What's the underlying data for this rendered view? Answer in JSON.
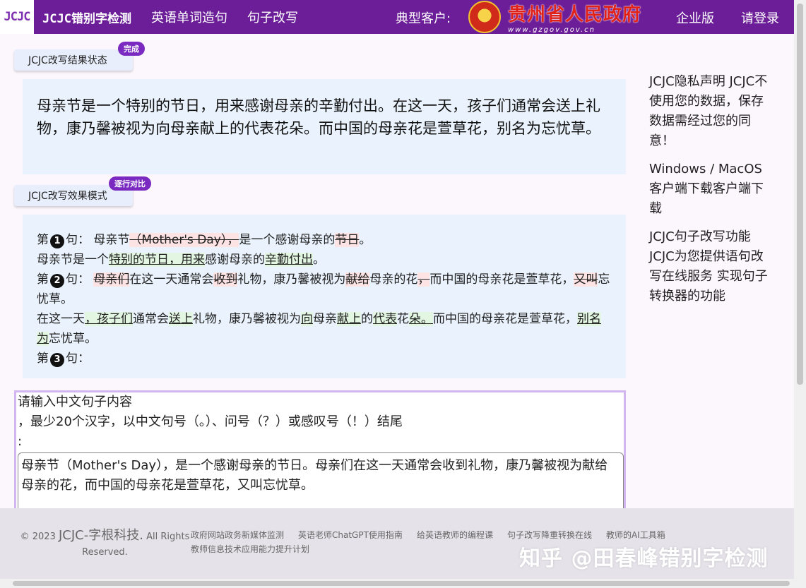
{
  "nav": {
    "logo": "JCJC",
    "links": [
      "JCJC错别字检测",
      "英语单词造句",
      "句子改写"
    ],
    "customer_label": "典型客户:",
    "gov_name": "贵州省人民政府",
    "gov_url": "www.gzgov.gov.cn",
    "enterprise": "企业版",
    "login": "请登录"
  },
  "status": {
    "label": "JCJC改写结果状态",
    "badge": "完成"
  },
  "result_text": "母亲节是一个特别的节日，用来感谢母亲的辛勤付出。在这一天，孩子们通常会送上礼物，康乃馨被视为向母亲献上的代表花朵。而中国的母亲花是萱草花，别名为忘忧草。",
  "mode": {
    "label": "JCJC改写效果模式",
    "badge": "逐行对比"
  },
  "compare": {
    "line_prefix": "第",
    "line_suffix": "句：",
    "s1": {
      "num": "1",
      "parts": [
        {
          "t": "母亲节",
          "k": "n"
        },
        {
          "t": "（Mother's Day），",
          "k": "d"
        },
        {
          "t": "是一个感谢母亲的",
          "k": "n"
        },
        {
          "t": "节日",
          "k": "d"
        },
        {
          "t": "。",
          "k": "n"
        }
      ],
      "rewrite": [
        {
          "t": "母亲节是一个",
          "k": "n"
        },
        {
          "t": "特别的节日，用来",
          "k": "i"
        },
        {
          "t": "感谢母亲的",
          "k": "n"
        },
        {
          "t": "辛勤付出",
          "k": "i"
        },
        {
          "t": "。",
          "k": "n"
        }
      ]
    },
    "s2": {
      "num": "2",
      "parts": [
        {
          "t": "母亲们",
          "k": "d"
        },
        {
          "t": "在这一天通常会",
          "k": "n"
        },
        {
          "t": "收到",
          "k": "d"
        },
        {
          "t": "礼物，康乃馨被视为",
          "k": "n"
        },
        {
          "t": "献给",
          "k": "d"
        },
        {
          "t": "母亲的花",
          "k": "n"
        },
        {
          "t": "，",
          "k": "d"
        },
        {
          "t": "而中国的母亲花是萱草花，",
          "k": "n"
        },
        {
          "t": "又叫",
          "k": "d"
        },
        {
          "t": "忘忧草。",
          "k": "n"
        }
      ],
      "rewrite": [
        {
          "t": "在这一天",
          "k": "n"
        },
        {
          "t": "，孩子们",
          "k": "i"
        },
        {
          "t": "通常会",
          "k": "n"
        },
        {
          "t": "送上",
          "k": "i"
        },
        {
          "t": "礼物，康乃馨被视为",
          "k": "n"
        },
        {
          "t": "向",
          "k": "i"
        },
        {
          "t": "母亲",
          "k": "n"
        },
        {
          "t": "献上",
          "k": "i"
        },
        {
          "t": "的",
          "k": "n"
        },
        {
          "t": "代表",
          "k": "i"
        },
        {
          "t": "花",
          "k": "n"
        },
        {
          "t": "朵。",
          "k": "i"
        },
        {
          "t": "而中国的母亲花是萱草花，",
          "k": "n"
        },
        {
          "t": "别名为",
          "k": "i"
        },
        {
          "t": "忘忧草。",
          "k": "n"
        }
      ]
    },
    "s3": {
      "num": "3"
    }
  },
  "input": {
    "label_line1": "请输入中文句子内容",
    "label_line2": "，最少20个汉字，以中文句号（。）、问号（？）或感叹号（！）结尾",
    "label_line3": ":",
    "value": "母亲节（Mother's Day），是一个感谢母亲的节日。母亲们在这一天通常会收到礼物，康乃馨被视为献给母亲的花，而中国的母亲花是萱草花，又叫忘忧草。"
  },
  "sidebar": {
    "privacy": "JCJC隐私声明 JCJC不使用您的数据，保存数据需经过您的同意！",
    "download": "Windows / MacOS 客户端下载客户端下载",
    "feature": "JCJC句子改写功能 JCJC为您提供语句改写在线服务 实现句子转换器的功能"
  },
  "footer": {
    "copyright_prefix": "© 2023",
    "brand": "JCJC-字根科技.",
    "rights": "All Rights Reserved.",
    "links": [
      "政府网站政务新媒体监测",
      "英语老师ChatGPT使用指南",
      "给英语教师的编程课",
      "句子改写降重转换在线",
      "教师的AI工具箱",
      "教师信息技术应用能力提升计划"
    ],
    "watermark": "知乎 @田春峰错别字检测"
  },
  "colors": {
    "nav_bg": "#6c1d98",
    "badge_bg": "#7a2ac0",
    "result_bg": "#eaf3fd",
    "delete_bg": "#fde3e3",
    "insert_bg": "#e2f6e2",
    "input_border": "#d3b5ef"
  }
}
